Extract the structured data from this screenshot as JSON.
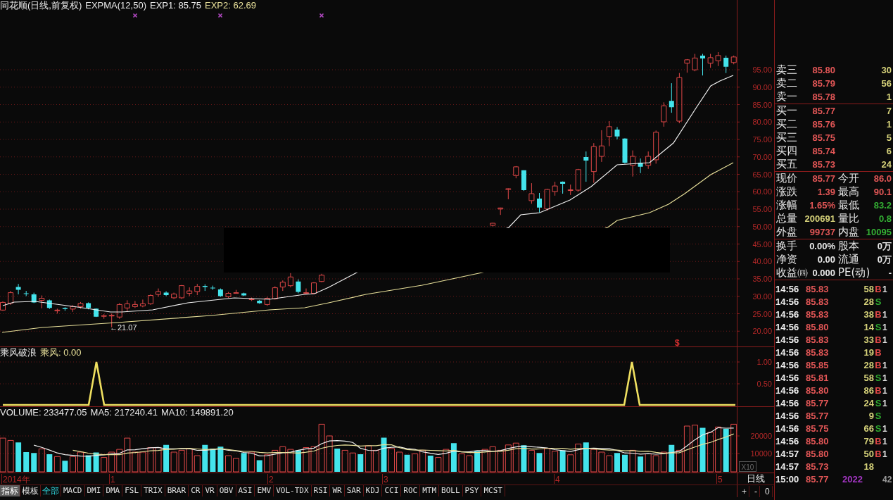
{
  "price_chart": {
    "title": "同花顺(日线,前复权)",
    "indicator": "EXPMA(12,50)",
    "legend": [
      {
        "label": "EXP1: 85.75",
        "color": "#f0f0f0"
      },
      {
        "label": "EXP2: 62.69",
        "color": "#e8e09a"
      }
    ],
    "y_axis": [
      "95.00",
      "90.00",
      "85.00",
      "80.00",
      "75.00",
      "70.00",
      "65.00",
      "60.00",
      "55.00",
      "50.00",
      "45.00",
      "40.00",
      "35.00",
      "30.00",
      "25.00",
      "20.00"
    ],
    "low_label": "←21.07",
    "signal_label": "$"
  },
  "signal_panel": {
    "title": "乘风破浪",
    "reading": "乘风: 0.00",
    "y_axis": [
      "1.00",
      "0.50"
    ]
  },
  "volume_panel": {
    "legend": [
      "VOLUME: 233477.05",
      "MA5: 217240.41",
      "MA10: 149891.20"
    ],
    "y_axis": [
      "20000",
      "10000"
    ],
    "scale": "X10"
  },
  "date_axis": [
    "2014年",
    "1",
    "2",
    "3",
    "4",
    "5"
  ],
  "period": "日线",
  "zoom_buttons": [
    "+",
    "-",
    "0"
  ],
  "indicator_tabs": [
    {
      "label": "指标",
      "kind": "mode",
      "selected": true
    },
    {
      "label": "模板",
      "kind": "mode",
      "selected": false
    },
    {
      "label": "全部",
      "kind": "group",
      "selected": false
    },
    {
      "label": "MACD",
      "kind": "indicator",
      "selected": false
    },
    {
      "label": "DMI",
      "kind": "indicator",
      "selected": false
    },
    {
      "label": "DMA",
      "kind": "indicator",
      "selected": false
    },
    {
      "label": "FSL",
      "kind": "indicator",
      "selected": false
    },
    {
      "label": "TRIX",
      "kind": "indicator",
      "selected": false
    },
    {
      "label": "BRAR",
      "kind": "indicator",
      "selected": false
    },
    {
      "label": "CR",
      "kind": "indicator",
      "selected": false
    },
    {
      "label": "VR",
      "kind": "indicator",
      "selected": false
    },
    {
      "label": "OBV",
      "kind": "indicator",
      "selected": false
    },
    {
      "label": "ASI",
      "kind": "indicator",
      "selected": false
    },
    {
      "label": "EMV",
      "kind": "indicator",
      "selected": false
    },
    {
      "label": "VOL-TDX",
      "kind": "indicator",
      "selected": false
    },
    {
      "label": "RSI",
      "kind": "indicator",
      "selected": false
    },
    {
      "label": "WR",
      "kind": "indicator",
      "selected": false
    },
    {
      "label": "SAR",
      "kind": "indicator",
      "selected": false
    },
    {
      "label": "KDJ",
      "kind": "indicator",
      "selected": false
    },
    {
      "label": "CCI",
      "kind": "indicator",
      "selected": false
    },
    {
      "label": "ROC",
      "kind": "indicator",
      "selected": false
    },
    {
      "label": "MTM",
      "kind": "indicator",
      "selected": false
    },
    {
      "label": "BOLL",
      "kind": "indicator",
      "selected": false
    },
    {
      "label": "PSY",
      "kind": "indicator",
      "selected": false
    },
    {
      "label": "MCST",
      "kind": "indicator",
      "selected": false
    }
  ],
  "order_book": {
    "asks": [
      {
        "label": "卖三",
        "price": "85.80",
        "volume": "30"
      },
      {
        "label": "卖二",
        "price": "85.79",
        "volume": "56"
      },
      {
        "label": "卖一",
        "price": "85.78",
        "volume": "1"
      }
    ],
    "bids": [
      {
        "label": "买一",
        "price": "85.77",
        "volume": "7"
      },
      {
        "label": "买二",
        "price": "85.76",
        "volume": "1"
      },
      {
        "label": "买三",
        "price": "85.75",
        "volume": "5"
      },
      {
        "label": "买四",
        "price": "85.74",
        "volume": "6"
      },
      {
        "label": "买五",
        "price": "85.73",
        "volume": "24"
      }
    ]
  },
  "quote": [
    {
      "left": {
        "label": "现价",
        "value": "85.77",
        "color": "#e25656"
      },
      "right": {
        "label": "今开",
        "value": "86.0",
        "color": "#e25656"
      }
    },
    {
      "left": {
        "label": "涨跌",
        "value": "1.39",
        "color": "#e25656"
      },
      "right": {
        "label": "最高",
        "value": "90.1",
        "color": "#e25656"
      }
    },
    {
      "left": {
        "label": "涨幅",
        "value": "1.65%",
        "color": "#e25656"
      },
      "right": {
        "label": "最低",
        "value": "83.2",
        "color": "#34b034"
      }
    },
    {
      "left": {
        "label": "总量",
        "value": "200691",
        "color": "#d6d27a"
      },
      "right": {
        "label": "量比",
        "value": "0.8",
        "color": "#34b034"
      }
    },
    {
      "left": {
        "label": "外盘",
        "value": "99737",
        "color": "#e25656"
      },
      "right": {
        "label": "内盘",
        "value": "10095",
        "color": "#34b034"
      }
    }
  ],
  "fundamentals": [
    {
      "left": {
        "label": "换手",
        "value": "0.00%"
      },
      "right": {
        "label": "股本",
        "value": "0万"
      }
    },
    {
      "left": {
        "label": "净资",
        "value": "0.00"
      },
      "right": {
        "label": "流通",
        "value": "0万"
      }
    },
    {
      "left": {
        "label": "收益㈣",
        "value": "0.000"
      },
      "right": {
        "label": "PE(动)",
        "value": "-"
      }
    }
  ],
  "trades": [
    {
      "time": "14:56",
      "price": "85.83",
      "volume": "58",
      "side": "B",
      "kind": "buy",
      "extra": "1"
    },
    {
      "time": "14:56",
      "price": "85.83",
      "volume": "28",
      "side": "S",
      "kind": "sell"
    },
    {
      "time": "14:56",
      "price": "85.83",
      "volume": "38",
      "side": "B",
      "kind": "buy",
      "extra": "1"
    },
    {
      "time": "14:56",
      "price": "85.80",
      "volume": "14",
      "side": "S",
      "kind": "sell",
      "extra": "1"
    },
    {
      "time": "14:56",
      "price": "85.83",
      "volume": "33",
      "side": "B",
      "kind": "buy",
      "extra": "1"
    },
    {
      "time": "14:56",
      "price": "85.83",
      "volume": "19",
      "side": "B",
      "kind": "buy"
    },
    {
      "time": "14:56",
      "price": "85.85",
      "volume": "28",
      "side": "B",
      "kind": "buy",
      "extra": "1"
    },
    {
      "time": "14:56",
      "price": "85.81",
      "volume": "58",
      "side": "S",
      "kind": "sell",
      "extra": "1"
    },
    {
      "time": "14:56",
      "price": "85.80",
      "volume": "86",
      "side": "B",
      "kind": "buy",
      "extra": "1"
    },
    {
      "time": "14:56",
      "price": "85.77",
      "volume": "24",
      "side": "S",
      "kind": "sell",
      "extra": "1"
    },
    {
      "time": "14:56",
      "price": "85.77",
      "volume": "9",
      "side": "S",
      "kind": "sell"
    },
    {
      "time": "14:56",
      "price": "85.75",
      "volume": "66",
      "side": "S",
      "kind": "sell",
      "extra": "1"
    },
    {
      "time": "14:56",
      "price": "85.80",
      "volume": "79",
      "side": "B",
      "kind": "buy",
      "extra": "1"
    },
    {
      "time": "14:57",
      "price": "85.80",
      "volume": "50",
      "side": "B",
      "kind": "buy",
      "extra": "1"
    },
    {
      "time": "14:57",
      "price": "85.73",
      "volume": "18",
      "kind": "neutral"
    },
    {
      "time": "15:00",
      "price": "85.77",
      "volume": "2022",
      "kind": "close",
      "extra": "42"
    }
  ]
}
